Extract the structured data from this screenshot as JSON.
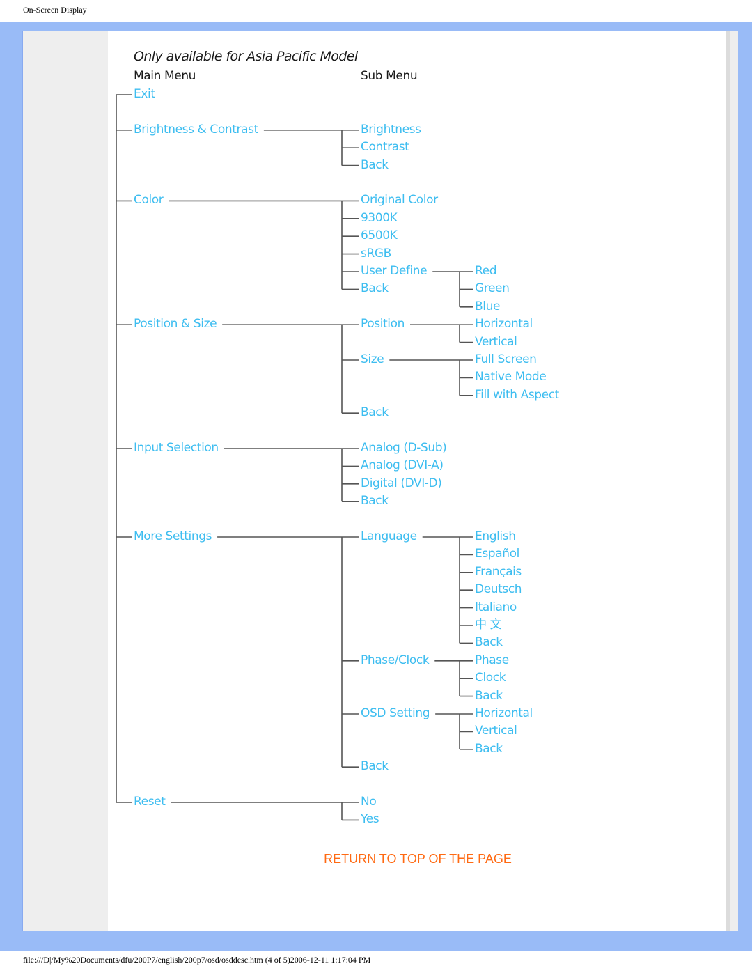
{
  "page_header": "On-Screen Display",
  "title": "Only available for Asia Pacific Model",
  "headers": {
    "main": "Main Menu",
    "sub": "Sub Menu"
  },
  "colors": {
    "frame": "#99bbf7",
    "item_text": "#3dbdf0",
    "link": "#ff6a13",
    "connector": "#555555"
  },
  "menu": [
    {
      "label": "Exit",
      "row": 0,
      "children": []
    },
    {
      "label": "Brightness & Contrast",
      "row": 2,
      "children": [
        {
          "label": "Brightness",
          "row": 2,
          "children": []
        },
        {
          "label": "Contrast",
          "row": 3,
          "children": []
        },
        {
          "label": "Back",
          "row": 4,
          "children": []
        }
      ]
    },
    {
      "label": "Color",
      "row": 6,
      "children": [
        {
          "label": "Original Color",
          "row": 6,
          "children": []
        },
        {
          "label": "9300K",
          "row": 7,
          "children": []
        },
        {
          "label": "6500K",
          "row": 8,
          "children": []
        },
        {
          "label": "sRGB",
          "row": 9,
          "children": []
        },
        {
          "label": "User Define",
          "row": 10,
          "children": [
            {
              "label": "Red",
              "row": 10
            },
            {
              "label": "Green",
              "row": 11
            },
            {
              "label": "Blue",
              "row": 12
            }
          ]
        },
        {
          "label": "Back",
          "row": 11,
          "children": []
        }
      ]
    },
    {
      "label": "Position & Size",
      "row": 13,
      "children": [
        {
          "label": "Position",
          "row": 13,
          "children": [
            {
              "label": "Horizontal",
              "row": 13
            },
            {
              "label": "Vertical",
              "row": 14
            }
          ]
        },
        {
          "label": "Size",
          "row": 15,
          "children": [
            {
              "label": "Full Screen",
              "row": 15
            },
            {
              "label": "Native Mode",
              "row": 16
            },
            {
              "label": "Fill with Aspect",
              "row": 17
            }
          ]
        },
        {
          "label": "Back",
          "row": 18,
          "children": []
        }
      ]
    },
    {
      "label": "Input Selection",
      "row": 20,
      "children": [
        {
          "label": "Analog (D-Sub)",
          "row": 20,
          "children": []
        },
        {
          "label": "Analog (DVI-A)",
          "row": 21,
          "children": []
        },
        {
          "label": "Digital (DVI-D)",
          "row": 22,
          "children": []
        },
        {
          "label": "Back",
          "row": 23,
          "children": []
        }
      ]
    },
    {
      "label": "More Settings",
      "row": 25,
      "children": [
        {
          "label": "Language",
          "row": 25,
          "children": [
            {
              "label": "English",
              "row": 25
            },
            {
              "label": "Español",
              "row": 26
            },
            {
              "label": "Français",
              "row": 27
            },
            {
              "label": "Deutsch",
              "row": 28
            },
            {
              "label": "Italiano",
              "row": 29
            },
            {
              "label": "中 文",
              "row": 30
            },
            {
              "label": "Back",
              "row": 31
            }
          ]
        },
        {
          "label": "Phase/Clock",
          "row": 32,
          "children": [
            {
              "label": "Phase",
              "row": 32
            },
            {
              "label": "Clock",
              "row": 33
            },
            {
              "label": "Back",
              "row": 34
            }
          ]
        },
        {
          "label": "OSD Setting",
          "row": 35,
          "children": [
            {
              "label": "Horizontal",
              "row": 35
            },
            {
              "label": "Vertical",
              "row": 36
            },
            {
              "label": "Back",
              "row": 37
            }
          ]
        },
        {
          "label": "Back",
          "row": 38,
          "children": []
        }
      ]
    },
    {
      "label": "Reset",
      "row": 40,
      "children": [
        {
          "label": "No",
          "row": 40,
          "children": []
        },
        {
          "label": "Yes",
          "row": 41,
          "children": []
        }
      ]
    }
  ],
  "return_link": "RETURN TO TOP OF THE PAGE",
  "footer": "file:///D|/My%20Documents/dfu/200P7/english/200p7/osd/osddesc.htm (4 of 5)2006-12-11 1:17:04 PM"
}
